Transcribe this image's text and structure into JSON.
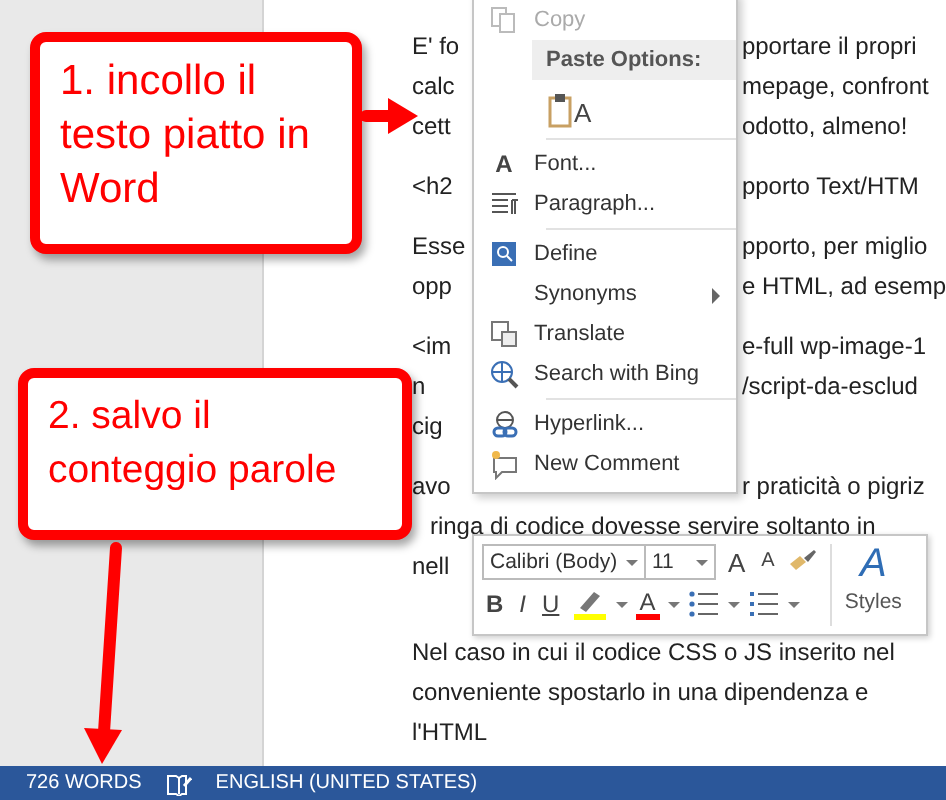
{
  "document": {
    "paragraphs": [
      {
        "lines": [
          {
            "left": "E' fo",
            "right": "pportare il propri"
          },
          {
            "left": "calc",
            "right": "mepage, confront"
          },
          {
            "left": "cett",
            "right": "odotto, almeno!"
          }
        ]
      },
      {
        "lines": [
          {
            "left": "<h2",
            "right": "pporto Text/HTM"
          }
        ]
      },
      {
        "lines": [
          {
            "left": "Esse",
            "right": "pporto, per miglio"
          },
          {
            "left": "opp",
            "right": "e HTML, ad esemp"
          }
        ]
      },
      {
        "lines": [
          {
            "left": "<im",
            "right": "e-full wp-image-1"
          },
          {
            "left": "n",
            "right": "/script-da-esclud"
          },
          {
            "left": "cig"
          }
        ]
      },
      {
        "lines": [
          {
            "left": "avo",
            "right": "r praticità o pigriz"
          },
          {
            "text": "ringa di codice dovesse servire soltanto in"
          },
          {
            "left": "nell"
          }
        ]
      },
      {
        "lines": [
          {
            "text": "Nel caso in cui il codice CSS o JS inserito nel"
          },
          {
            "text": "conveniente spostarlo in una dipendenza e"
          },
          {
            "text": "l'HTML"
          }
        ]
      }
    ]
  },
  "context_menu": {
    "items": [
      {
        "kind": "item",
        "label": "Copy",
        "disabled": true
      },
      {
        "kind": "header",
        "label": "Paste Options:"
      },
      {
        "kind": "paste",
        "glyph": "A"
      },
      {
        "kind": "separator"
      },
      {
        "kind": "item",
        "label": "Font...",
        "glyph": "A",
        "disabled": false
      },
      {
        "kind": "item",
        "label": "Paragraph...",
        "disabled": false
      },
      {
        "kind": "separator"
      },
      {
        "kind": "item",
        "label": "Define",
        "disabled": false
      },
      {
        "kind": "item",
        "label": "Synonyms",
        "disabled": false,
        "submenu": true
      },
      {
        "kind": "item",
        "label": "Translate",
        "disabled": false
      },
      {
        "kind": "item",
        "label": "Search with Bing",
        "disabled": false
      },
      {
        "kind": "separator"
      },
      {
        "kind": "item",
        "label": "Hyperlink...",
        "disabled": false
      },
      {
        "kind": "item",
        "label": "New Comment",
        "disabled": false
      }
    ]
  },
  "mini_toolbar": {
    "font": "Calibri (Body)",
    "size": "11",
    "top_buttons": [
      {
        "kind": "grow",
        "glyph": "A"
      },
      {
        "kind": "shrink",
        "glyph": "A"
      },
      {
        "kind": "painter"
      }
    ],
    "styles": {
      "glyph": "A",
      "label": "Styles"
    },
    "bottom_buttons": [
      {
        "kind": "bold",
        "glyph": "B"
      },
      {
        "kind": "italic",
        "glyph": "I"
      },
      {
        "kind": "underline",
        "glyph": "U"
      },
      {
        "kind": "highlight",
        "color": "#ffff00"
      },
      {
        "kind": "font_color",
        "glyph": "A",
        "color": "#ff0000"
      },
      {
        "kind": "bullets"
      },
      {
        "kind": "numbering"
      }
    ]
  },
  "callouts": [
    {
      "text": "1. incollo il testo piatto in Word"
    },
    {
      "text": "2. salvo il conteggio parole"
    }
  ],
  "status_bar": {
    "words": "726 WORDS",
    "language": "ENGLISH (UNITED STATES)"
  }
}
